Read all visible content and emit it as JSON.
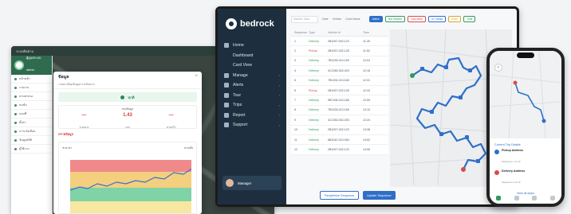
{
  "left_app": {
    "topbar_brand": "ระบบติดตาม",
    "sidebar": {
      "user_name": "ผู้ดูแลระบบ",
      "user_role": "admin",
      "items": [
        "หน้าหลัก",
        "รายงาน",
        "ยานพาหนะ",
        "คนขับ",
        "แผนที่",
        "ตั้งค่า",
        "การแจ้งเตือน",
        "ข้อมูลสถิติ",
        "ผู้ใช้งาน"
      ]
    },
    "dialog": {
      "title": "ข้อมูล",
      "subtitle": "รายละเอียดข้อมูลการเดินทาง",
      "close": "×",
      "status": "ปกติ",
      "stats_title": "สรุปข้อมูล",
      "stats": [
        {
          "value": "—",
          "label": "ระยะทาง"
        },
        {
          "value": "1.43",
          "label": "เวลา"
        },
        {
          "value": "—",
          "label": "ความเร็ว"
        }
      ],
      "section_label": "กราฟข้อมูล",
      "chart_head_left": "ช่วงเวลา",
      "chart_head_right": "ค่าเฉลี่ย"
    }
  },
  "bedrock": {
    "brand": "bedrock",
    "nav": [
      {
        "label": "Home",
        "icon": "home-icon",
        "chevron": false
      },
      {
        "label": "Dashboard",
        "icon": "",
        "chevron": false
      },
      {
        "label": "Card View",
        "icon": "",
        "chevron": false
      },
      {
        "label": "Manage",
        "icon": "users-icon",
        "chevron": true
      },
      {
        "label": "Alerts",
        "icon": "bell-icon",
        "chevron": true
      },
      {
        "label": "Tour",
        "icon": "tour-icon",
        "chevron": true
      },
      {
        "label": "Trips",
        "icon": "pin-icon",
        "chevron": true
      },
      {
        "label": "Report",
        "icon": "report-icon",
        "chevron": true
      },
      {
        "label": "Support",
        "icon": "support-icon",
        "chevron": true
      }
    ],
    "user_label": "Manager",
    "toolbar": {
      "search_placeholder": "Search Trips",
      "filters": [
        "Date",
        "Vehicle",
        "Card Name"
      ],
      "chips": [
        {
          "label": "Active",
          "color": "#2f6fc8",
          "bg": "#2f6fc8",
          "text": "#ffffff"
        },
        {
          "label": "Not Started",
          "color": "#2f9a5b",
          "bg": "#ffffff",
          "text": "#2f9a5b"
        },
        {
          "label": "Cancelled",
          "color": "#d84b4b",
          "bg": "#ffffff",
          "text": "#d84b4b"
        },
        {
          "label": "In Transit",
          "color": "#2f6fc8",
          "bg": "#ffffff",
          "text": "#2f6fc8"
        },
        {
          "label": "Done",
          "color": "#d9a52b",
          "bg": "#ffffff",
          "text": "#d9a52b"
        },
        {
          "label": "Total",
          "color": "#2f9a5b",
          "bg": "#ffffff",
          "text": "#2f9a5b"
        }
      ]
    },
    "table": {
      "headers": [
        "Sequence",
        "Type",
        "Vehicle Id",
        "Time"
      ],
      "rows": [
        [
          "1",
          "Delivery",
          "2B1097-002-123",
          "11:49"
        ],
        [
          "2",
          "Pickup",
          "2B1097-002-125",
          "11:52"
        ],
        [
          "3",
          "Delivery",
          "7B1226-013-169",
          "12:04"
        ],
        [
          "4",
          "Delivery",
          "4C1082-002-003",
          "12:18"
        ],
        [
          "5",
          "Delivery",
          "7B1226-013-169",
          "12:31"
        ],
        [
          "6",
          "Pickup",
          "2B1097-002-125",
          "12:44"
        ],
        [
          "7",
          "Delivery",
          "9B7108-023-185",
          "12:59"
        ],
        [
          "8",
          "Delivery",
          "7B1226-013-169",
          "13:10"
        ],
        [
          "9",
          "Delivery",
          "4C1082-002-003",
          "13:24"
        ],
        [
          "10",
          "Delivery",
          "2B1097-002-123",
          "13:38"
        ],
        [
          "11",
          "Delivery",
          "6B1042-010-054",
          "13:52"
        ],
        [
          "12",
          "Delivery",
          "2B1097-002-123",
          "14:06"
        ]
      ]
    },
    "buttons": {
      "secondary": "Reoptimize Sequence",
      "primary": "Update Sequence"
    }
  },
  "phone": {
    "back": "‹",
    "panel_label": "Current Trip Details",
    "stops": [
      {
        "title": "Pickup Address",
        "sub": "Sequence 1 of 12",
        "color": "#2f6fc8"
      },
      {
        "title": "Delivery Address",
        "sub": "Sequence 2 of 12",
        "color": "#d84b4b"
      }
    ],
    "link": "View all stops"
  }
}
